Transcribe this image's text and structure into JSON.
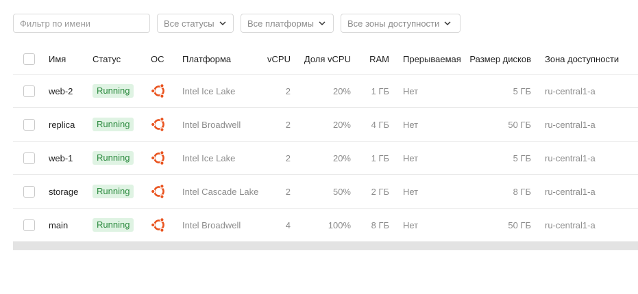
{
  "filters": {
    "name_placeholder": "Фильтр по имени",
    "status_select": "Все статусы",
    "platform_select": "Все платформы",
    "zone_select": "Все зоны доступности"
  },
  "table": {
    "headers": {
      "name": "Имя",
      "status": "Статус",
      "os": "ОС",
      "platform": "Платформа",
      "vcpu": "vCPU",
      "vcpu_share": "Доля vCPU",
      "ram": "RAM",
      "preemptible": "Прерываемая",
      "disk_size": "Размер дисков",
      "zone": "Зона доступности"
    },
    "rows": [
      {
        "name": "web-2",
        "status": "Running",
        "os": "ubuntu-icon",
        "platform": "Intel Ice Lake",
        "vcpu": "2",
        "vcpu_share": "20%",
        "ram": "1 ГБ",
        "preemptible": "Нет",
        "disk_size": "5 ГБ",
        "zone": "ru-central1-a"
      },
      {
        "name": "replica",
        "status": "Running",
        "os": "ubuntu-icon",
        "platform": "Intel Broadwell",
        "vcpu": "2",
        "vcpu_share": "20%",
        "ram": "4 ГБ",
        "preemptible": "Нет",
        "disk_size": "50 ГБ",
        "zone": "ru-central1-a"
      },
      {
        "name": "web-1",
        "status": "Running",
        "os": "ubuntu-icon",
        "platform": "Intel Ice Lake",
        "vcpu": "2",
        "vcpu_share": "20%",
        "ram": "1 ГБ",
        "preemptible": "Нет",
        "disk_size": "5 ГБ",
        "zone": "ru-central1-a"
      },
      {
        "name": "storage",
        "status": "Running",
        "os": "ubuntu-icon",
        "platform": "Intel Cascade Lake",
        "vcpu": "2",
        "vcpu_share": "50%",
        "ram": "2 ГБ",
        "preemptible": "Нет",
        "disk_size": "8 ГБ",
        "zone": "ru-central1-a"
      },
      {
        "name": "main",
        "status": "Running",
        "os": "ubuntu-icon",
        "platform": "Intel Broadwell",
        "vcpu": "4",
        "vcpu_share": "100%",
        "ram": "8 ГБ",
        "preemptible": "Нет",
        "disk_size": "50 ГБ",
        "zone": "ru-central1-a"
      }
    ]
  },
  "colors": {
    "status_running_bg": "#dff3e3",
    "status_running_text": "#2b8a3e",
    "ubuntu_orange": "#e95420"
  }
}
